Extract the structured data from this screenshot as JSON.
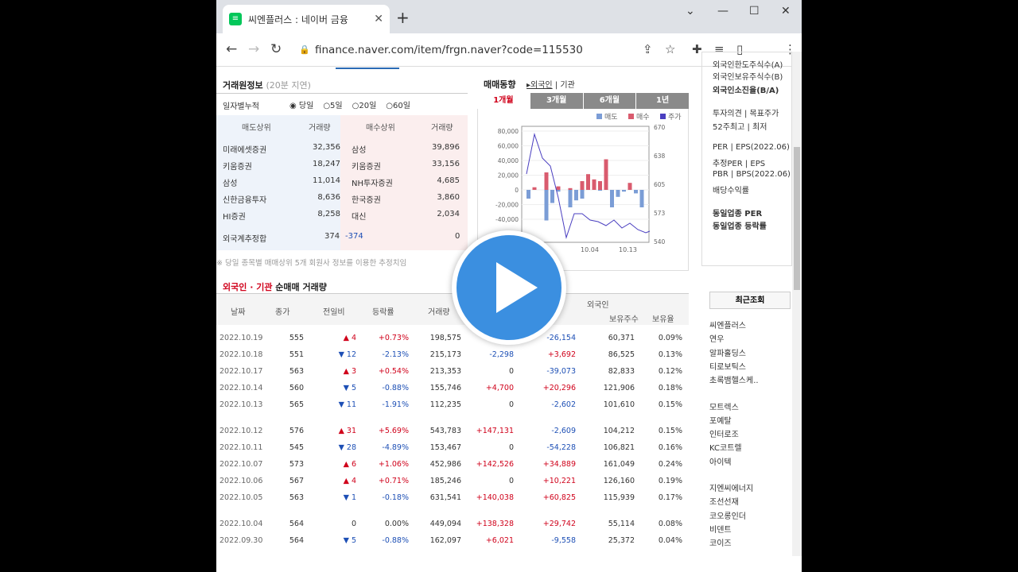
{
  "tab": {
    "title": "씨엔플러스 : 네이버 금융"
  },
  "address": {
    "url": "finance.naver.com/item/frgn.naver?code=115530"
  },
  "trade": {
    "title": "거래원정보",
    "delay": "(20분 지연)",
    "period_label": "일자별누적",
    "radio": [
      "당일",
      "5일",
      "20일",
      "60일"
    ],
    "headers": [
      "매도상위",
      "거래량",
      "매수상위",
      "거래량"
    ],
    "rows": [
      [
        "미래에셋증권",
        "32,356",
        "삼성",
        "39,896"
      ],
      [
        "키움증권",
        "18,247",
        "키움증권",
        "33,156"
      ],
      [
        "삼성",
        "11,014",
        "NH투자증권",
        "4,685"
      ],
      [
        "신한금융투자",
        "8,636",
        "한국증권",
        "3,860"
      ],
      [
        "HI증권",
        "8,258",
        "대신",
        "2,034"
      ]
    ],
    "foreign": [
      "외국계추정합",
      "374",
      "-374",
      "0"
    ],
    "note": "※ 당일 종목별 매매상위 5개 회원사 정보를 이용한 추정치임"
  },
  "chart_tabs": {
    "label": "매매동향",
    "opt1": "외국인",
    "opt2": "기관",
    "tabs": [
      "1개월",
      "3개월",
      "6개월",
      "1년"
    ],
    "legend": [
      "매도",
      "매수",
      "주가"
    ]
  },
  "chart_data": {
    "type": "bar",
    "ylim": [
      -60000,
      80000
    ],
    "yticks": [
      "80,000",
      "60,000",
      "40,000",
      "20,000",
      "0",
      "-20,000",
      "-40,000"
    ],
    "y2ticks": [
      "670",
      "638",
      "605",
      "573",
      "540"
    ],
    "xticks": [
      "10.04",
      "10.13"
    ]
  },
  "net_title": {
    "a": "외국인 · 기관",
    "b": "순매매 거래량"
  },
  "table": {
    "headers": [
      "날짜",
      "종가",
      "전일비",
      "등락률",
      "거래량",
      "",
      "외국인",
      "보유주수",
      "보유율"
    ],
    "rows": [
      [
        "2022.10.19",
        "555",
        "▲ 4",
        "+0.73%",
        "198,575",
        "",
        "-26,154",
        "60,371",
        "0.09%"
      ],
      [
        "2022.10.18",
        "551",
        "▼ 12",
        "-2.13%",
        "215,173",
        "-2,298",
        "+3,692",
        "86,525",
        "0.13%"
      ],
      [
        "2022.10.17",
        "563",
        "▲ 3",
        "+0.54%",
        "213,353",
        "0",
        "-39,073",
        "82,833",
        "0.12%"
      ],
      [
        "2022.10.14",
        "560",
        "▼ 5",
        "-0.88%",
        "155,746",
        "+4,700",
        "+20,296",
        "121,906",
        "0.18%"
      ],
      [
        "2022.10.13",
        "565",
        "▼ 11",
        "-1.91%",
        "112,235",
        "0",
        "-2,602",
        "101,610",
        "0.15%"
      ],
      [
        "2022.10.12",
        "576",
        "▲ 31",
        "+5.69%",
        "543,783",
        "+147,131",
        "-2,609",
        "104,212",
        "0.15%"
      ],
      [
        "2022.10.11",
        "545",
        "▼ 28",
        "-4.89%",
        "153,467",
        "0",
        "-54,228",
        "106,821",
        "0.16%"
      ],
      [
        "2022.10.07",
        "573",
        "▲ 6",
        "+1.06%",
        "452,986",
        "+142,526",
        "+34,889",
        "161,049",
        "0.24%"
      ],
      [
        "2022.10.06",
        "567",
        "▲ 4",
        "+0.71%",
        "185,246",
        "0",
        "+10,221",
        "126,160",
        "0.19%"
      ],
      [
        "2022.10.05",
        "563",
        "▼ 1",
        "-0.18%",
        "631,541",
        "+140,038",
        "+60,825",
        "115,939",
        "0.17%"
      ],
      [
        "2022.10.04",
        "564",
        "0",
        "0.00%",
        "449,094",
        "+138,328",
        "+29,742",
        "55,114",
        "0.08%"
      ],
      [
        "2022.09.30",
        "564",
        "▼ 5",
        "-0.88%",
        "162,097",
        "+6,021",
        "-9,558",
        "25,372",
        "0.04%"
      ]
    ]
  },
  "side": {
    "items": [
      "외국인한도주식수(A)",
      "외국인보유주식수(B)",
      "외국인소진율(B/A)",
      "투자의견 | 목표주가",
      "52주최고 | 최저",
      "PER | EPS(2022.06)",
      "추정PER | EPS",
      "PBR | BPS(2022.06)",
      "배당수익률",
      "동일업종 PER",
      "동일업종 등락률"
    ]
  },
  "recent": {
    "title": "최근조회",
    "items": [
      "씨엔플러스",
      "연우",
      "알파홀딩스",
      "티로보틱스",
      "초록뱀헬스케..",
      "모트렉스",
      "포예탈",
      "인터로조",
      "KC코트렐",
      "아이텍",
      "지엔씨에너지",
      "조선선재",
      "코오롱인더",
      "비덴트",
      "코이즈"
    ]
  }
}
